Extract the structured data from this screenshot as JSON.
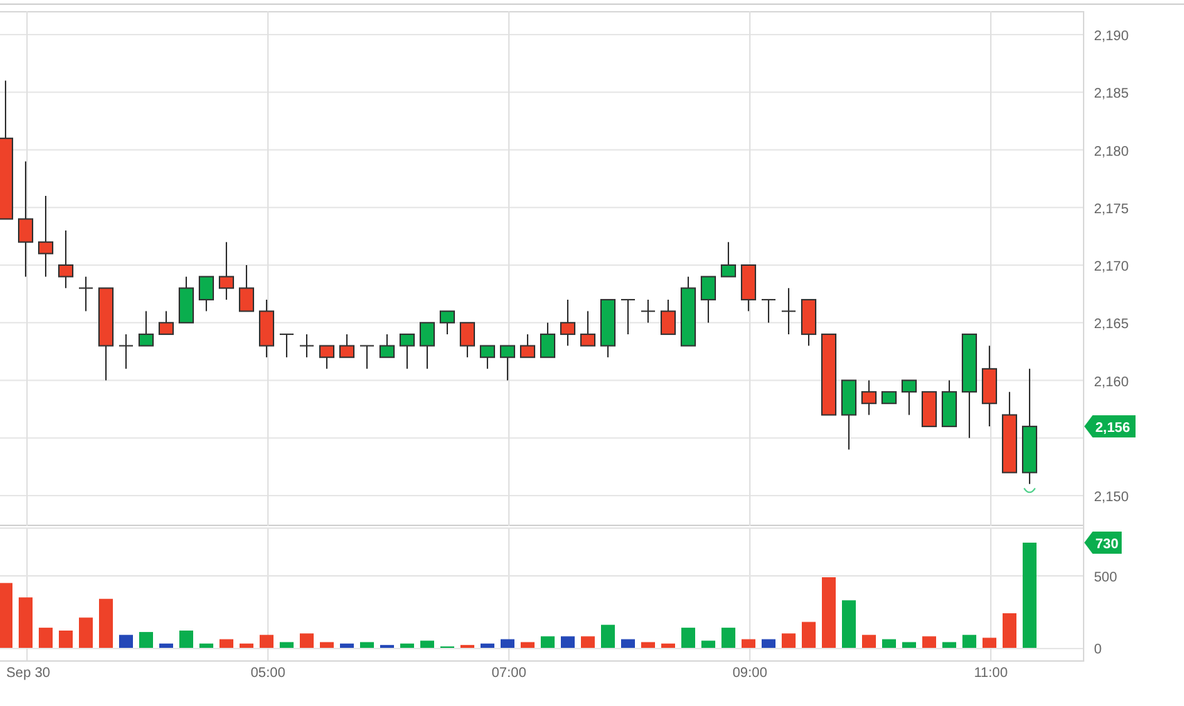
{
  "price_chart": {
    "chart_data": {
      "type": "candlestick",
      "grid": true,
      "ylim": [
        2150,
        2190
      ],
      "yticks": [
        {
          "value": 2150,
          "label": "2,150"
        },
        {
          "value": 2160,
          "label": "2,160"
        },
        {
          "value": 2165,
          "label": "2,165"
        },
        {
          "value": 2170,
          "label": "2,170"
        },
        {
          "value": 2175,
          "label": "2,175"
        },
        {
          "value": 2180,
          "label": "2,180"
        },
        {
          "value": 2185,
          "label": "2,185"
        },
        {
          "value": 2190,
          "label": "2,190"
        }
      ],
      "ohlc": [
        [
          2181,
          2186,
          2174,
          2174
        ],
        [
          2174,
          2179,
          2169,
          2172
        ],
        [
          2172,
          2176,
          2169,
          2171
        ],
        [
          2170,
          2173,
          2168,
          2169
        ],
        [
          2168,
          2169,
          2166,
          2168
        ],
        [
          2168,
          2168,
          2160,
          2163
        ],
        [
          2163,
          2164,
          2161,
          2163
        ],
        [
          2163,
          2166,
          2163,
          2164
        ],
        [
          2165,
          2166,
          2164,
          2164
        ],
        [
          2165,
          2169,
          2165,
          2168
        ],
        [
          2167,
          2169,
          2166,
          2169
        ],
        [
          2169,
          2172,
          2167,
          2168
        ],
        [
          2168,
          2170,
          2166,
          2166
        ],
        [
          2166,
          2167,
          2162,
          2163
        ],
        [
          2164,
          2164,
          2162,
          2164
        ],
        [
          2163,
          2164,
          2162,
          2163
        ],
        [
          2163,
          2163,
          2161,
          2162
        ],
        [
          2163,
          2164,
          2162,
          2162
        ],
        [
          2163,
          2163,
          2161,
          2163
        ],
        [
          2162,
          2164,
          2162,
          2163
        ],
        [
          2163,
          2164,
          2161,
          2164
        ],
        [
          2163,
          2165,
          2161,
          2165
        ],
        [
          2165,
          2166,
          2164,
          2166
        ],
        [
          2165,
          2165,
          2162,
          2163
        ],
        [
          2162,
          2163,
          2161,
          2163
        ],
        [
          2162,
          2163,
          2160,
          2163
        ],
        [
          2163,
          2164,
          2162,
          2162
        ],
        [
          2162,
          2165,
          2162,
          2164
        ],
        [
          2165,
          2167,
          2163,
          2164
        ],
        [
          2164,
          2166,
          2163,
          2163
        ],
        [
          2163,
          2167,
          2162,
          2167
        ],
        [
          2167,
          2167,
          2164,
          2167
        ],
        [
          2166,
          2167,
          2165,
          2166
        ],
        [
          2166,
          2167,
          2164,
          2164
        ],
        [
          2163,
          2169,
          2163,
          2168
        ],
        [
          2167,
          2169,
          2165,
          2169
        ],
        [
          2169,
          2172,
          2169,
          2170
        ],
        [
          2170,
          2170,
          2166,
          2167
        ],
        [
          2167,
          2167,
          2165,
          2167
        ],
        [
          2166,
          2168,
          2164,
          2166
        ],
        [
          2167,
          2167,
          2163,
          2164
        ],
        [
          2164,
          2164,
          2157,
          2157
        ],
        [
          2157,
          2160,
          2154,
          2160
        ],
        [
          2159,
          2160,
          2157,
          2158
        ],
        [
          2158,
          2159,
          2158,
          2159
        ],
        [
          2159,
          2160,
          2157,
          2160
        ],
        [
          2159,
          2159,
          2156,
          2156
        ],
        [
          2156,
          2160,
          2156,
          2159
        ],
        [
          2159,
          2164,
          2155,
          2164
        ],
        [
          2161,
          2163,
          2156,
          2158
        ],
        [
          2157,
          2159,
          2152,
          2152
        ],
        [
          2152,
          2161,
          2151,
          2156
        ]
      ]
    },
    "last_price_tag": "2,156"
  },
  "volume_chart": {
    "chart_data": {
      "type": "bar",
      "grid": true,
      "ylim": [
        0,
        730
      ],
      "yticks": [
        0,
        500
      ],
      "ref_lines": [
        {
          "axis": "y",
          "value": 500
        }
      ],
      "categories": [
        null,
        "Sep 30",
        null,
        null,
        null,
        null,
        null,
        null,
        null,
        null,
        null,
        null,
        null,
        "05:00",
        null,
        null,
        null,
        null,
        null,
        null,
        null,
        null,
        null,
        null,
        null,
        "07:00",
        null,
        null,
        null,
        null,
        null,
        null,
        null,
        null,
        null,
        null,
        null,
        "09:00",
        null,
        null,
        null,
        null,
        null,
        null,
        null,
        null,
        null,
        null,
        null,
        "11:00",
        null,
        null
      ],
      "series": [
        {
          "color": "#ee4229",
          "values": [
            450,
            350,
            140,
            120,
            210,
            340,
            null,
            null,
            null,
            null,
            null,
            60,
            30,
            90,
            null,
            100,
            40,
            null,
            null,
            null,
            null,
            null,
            null,
            20,
            null,
            null,
            40,
            null,
            null,
            80,
            null,
            null,
            40,
            30,
            null,
            null,
            null,
            60,
            null,
            100,
            180,
            490,
            null,
            90,
            null,
            null,
            80,
            null,
            null,
            70,
            240,
            null
          ]
        },
        {
          "color": "#0aae4e",
          "values": [
            null,
            null,
            null,
            null,
            null,
            null,
            null,
            110,
            null,
            120,
            30,
            null,
            null,
            null,
            40,
            null,
            null,
            null,
            40,
            null,
            30,
            50,
            10,
            null,
            null,
            null,
            null,
            80,
            null,
            null,
            160,
            null,
            null,
            null,
            140,
            50,
            140,
            null,
            null,
            null,
            null,
            null,
            330,
            null,
            60,
            40,
            null,
            40,
            90,
            null,
            null,
            730
          ]
        },
        {
          "color": "#2448b8",
          "values": [
            null,
            null,
            null,
            null,
            null,
            null,
            90,
            null,
            30,
            null,
            null,
            null,
            null,
            null,
            null,
            null,
            null,
            30,
            null,
            20,
            null,
            null,
            null,
            null,
            30,
            60,
            null,
            null,
            80,
            null,
            null,
            60,
            null,
            null,
            null,
            null,
            null,
            null,
            60,
            null,
            null,
            null,
            null,
            null,
            null,
            null,
            null,
            null,
            null,
            null,
            null,
            null
          ]
        }
      ]
    },
    "last_volume_tag": "730"
  }
}
